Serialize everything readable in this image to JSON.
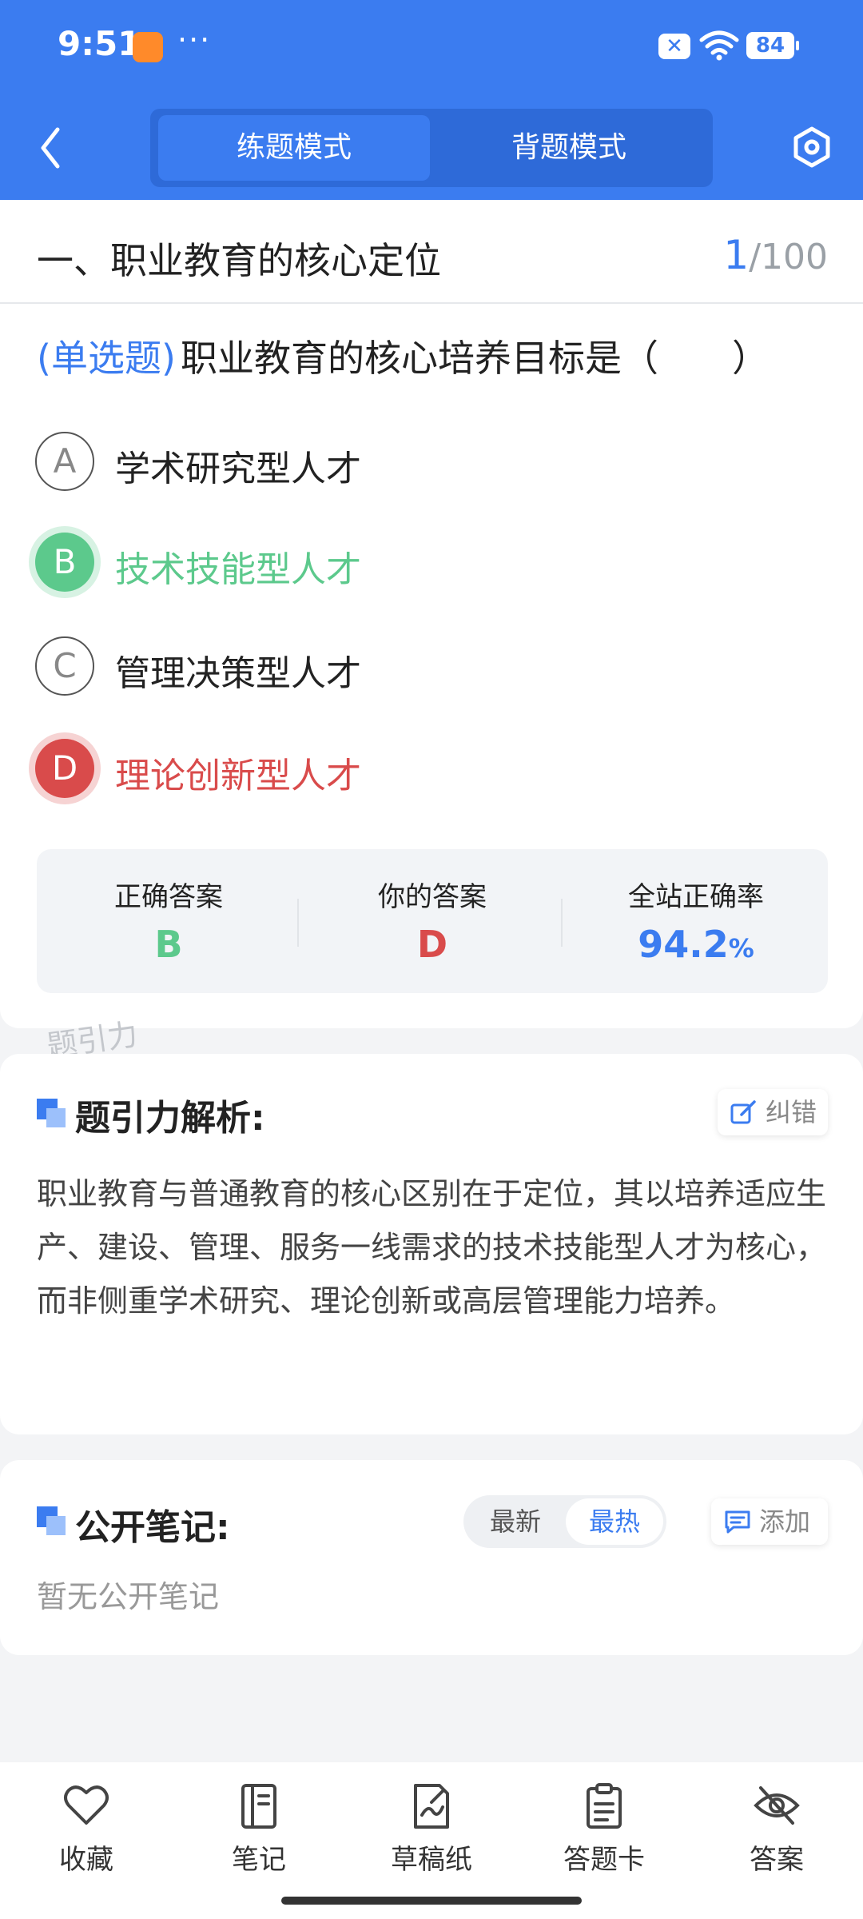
{
  "status_bar": {
    "time": "9:51",
    "dots": "···",
    "battery": "84"
  },
  "header": {
    "tabs": [
      {
        "label": "练题模式",
        "active": true
      },
      {
        "label": "背题模式",
        "active": false
      }
    ]
  },
  "question": {
    "chapter": "一、职业教育的核心定位",
    "progress_current": "1",
    "progress_total": "/100",
    "type": "(单选题)",
    "text": "职业教育的核心培养目标是（　　）",
    "options": [
      {
        "letter": "A",
        "text": "学术研究型人才",
        "state": "normal"
      },
      {
        "letter": "B",
        "text": "技术技能型人才",
        "state": "correct"
      },
      {
        "letter": "C",
        "text": "管理决策型人才",
        "state": "normal"
      },
      {
        "letter": "D",
        "text": "理论创新型人才",
        "state": "wrong"
      }
    ]
  },
  "answer_summary": {
    "correct_label": "正确答案",
    "correct_value": "B",
    "yours_label": "你的答案",
    "yours_value": "D",
    "rate_label": "全站正确率",
    "rate_value": "94.2",
    "rate_unit": "%"
  },
  "watermark": "题引力",
  "analysis": {
    "title": "题引力解析:",
    "correct_button": "纠错",
    "text": "职业教育与普通教育的核心区别在于定位，其以培养适应生产、建设、管理、服务一线需求的技术技能型人才为核心，而非侧重学术研究、理论创新或高层管理能力培养。"
  },
  "notes": {
    "title": "公开笔记:",
    "sort_options": [
      {
        "label": "最新",
        "active": false
      },
      {
        "label": "最热",
        "active": true
      }
    ],
    "add_button": "添加",
    "empty_text": "暂无公开笔记"
  },
  "bottom_tabs": [
    {
      "label": "收藏",
      "icon": "heart-icon"
    },
    {
      "label": "笔记",
      "icon": "notebook-icon"
    },
    {
      "label": "草稿纸",
      "icon": "draft-icon"
    },
    {
      "label": "答题卡",
      "icon": "clipboard-icon"
    },
    {
      "label": "答案",
      "icon": "eye-off-icon"
    }
  ],
  "colors": {
    "primary": "#3b7cf0",
    "correct": "#5cc98c",
    "wrong": "#d94b4b"
  }
}
